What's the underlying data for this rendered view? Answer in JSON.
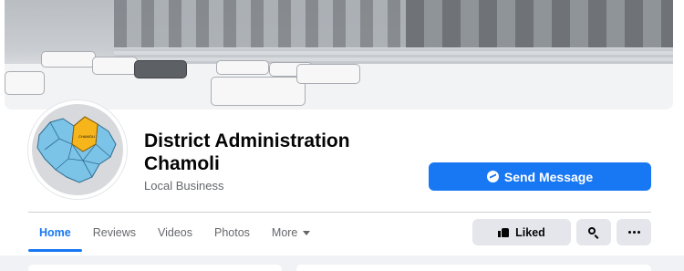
{
  "page": {
    "name": "District Administration Chamoli",
    "category": "Local Business"
  },
  "avatar": {
    "map_label": "CHAMOLI",
    "highlight_color": "#f5b51b",
    "map_color": "#7cc3e8"
  },
  "actions": {
    "send_message": "Send Message",
    "liked": "Liked"
  },
  "tabs": [
    {
      "label": "Home",
      "active": true
    },
    {
      "label": "Reviews",
      "active": false
    },
    {
      "label": "Videos",
      "active": false
    },
    {
      "label": "Photos",
      "active": false
    },
    {
      "label": "More",
      "active": false,
      "has_dropdown": true
    }
  ],
  "colors": {
    "accent": "#1877f2",
    "secondary_button": "#e4e6eb",
    "muted_text": "#65676b"
  }
}
